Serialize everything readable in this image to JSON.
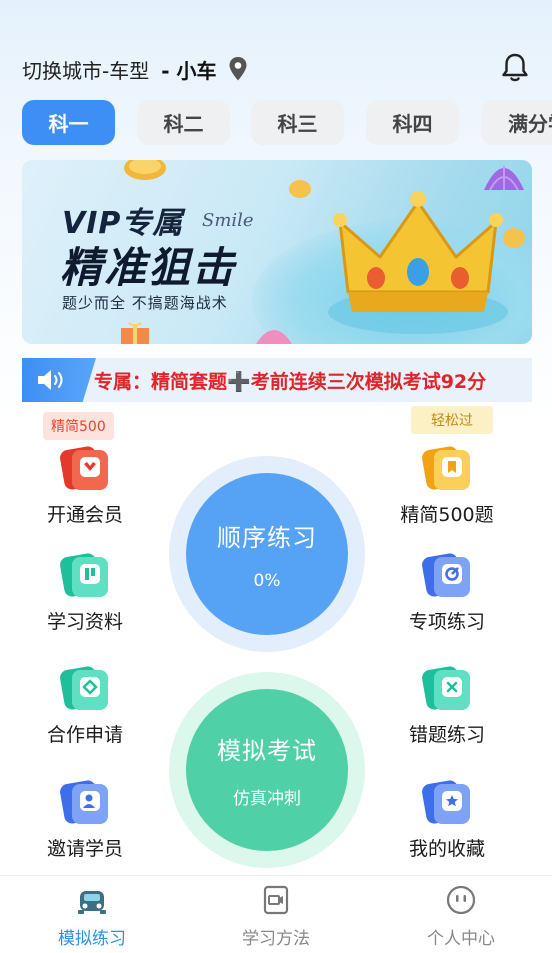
{
  "header": {
    "city_label": "切换城市-车型",
    "car_type": "- 小车"
  },
  "tabs": [
    {
      "label": "科一",
      "active": true
    },
    {
      "label": "科二",
      "active": false
    },
    {
      "label": "科三",
      "active": false
    },
    {
      "label": "科四",
      "active": false
    },
    {
      "label": "满分学习",
      "active": false
    }
  ],
  "banner": {
    "title1": "VIP专属",
    "title2": "精准狙击",
    "subtitle": "题少而全 不搞题海战术",
    "script_text": "Smile"
  },
  "notice": {
    "text_before": "专属：精简套题",
    "plus": "➕",
    "text_after": "考前连续三次模拟考试92分"
  },
  "left_items": [
    {
      "label": "开通会员",
      "icon": "vip-card-icon",
      "badge": "精简500"
    },
    {
      "label": "学习资料",
      "icon": "study-material-icon"
    },
    {
      "label": "合作申请",
      "icon": "cooperation-icon"
    },
    {
      "label": "邀请学员",
      "icon": "invite-user-icon"
    }
  ],
  "right_items": [
    {
      "label": "精简500题",
      "icon": "bookmark-card-icon",
      "badge": "轻松过"
    },
    {
      "label": "专项练习",
      "icon": "target-icon"
    },
    {
      "label": "错题练习",
      "icon": "wrong-question-icon"
    },
    {
      "label": "我的收藏",
      "icon": "favorite-folder-icon"
    }
  ],
  "sequential": {
    "title": "顺序练习",
    "progress": "0%"
  },
  "mock_exam": {
    "title": "模拟考试",
    "subtitle": "仿真冲刺"
  },
  "bottom_nav": [
    {
      "label": "模拟练习",
      "icon": "car-icon",
      "active": true
    },
    {
      "label": "学习方法",
      "icon": "video-doc-icon",
      "active": false
    },
    {
      "label": "个人中心",
      "icon": "smiley-icon",
      "active": false
    }
  ],
  "colors": {
    "accent": "#3d8ff5",
    "sequential_circle": "#56a2f5",
    "mock_circle": "#4fd0a6",
    "notice_text": "#e0242a"
  }
}
